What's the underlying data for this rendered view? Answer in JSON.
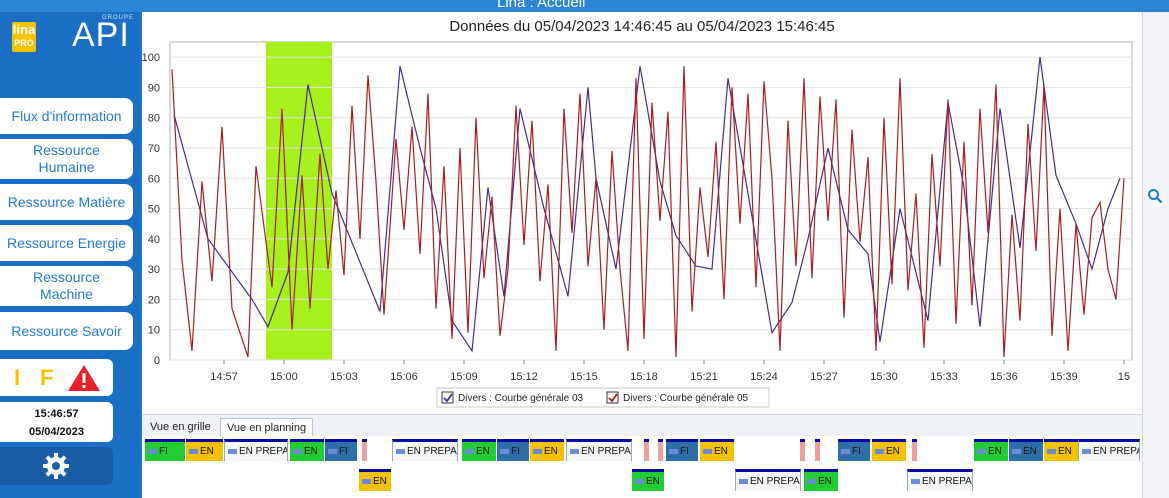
{
  "window": {
    "title": "Lina : Accueil"
  },
  "logo": {
    "lina": "lina",
    "pro": "PRO",
    "api": "API",
    "groupe": "GROUPE"
  },
  "sidebar": {
    "items": [
      {
        "label": "Flux d'information"
      },
      {
        "label": "Ressource Humaine"
      },
      {
        "label": "Ressource Matière"
      },
      {
        "label": "Ressource Energie"
      },
      {
        "label": "Ressource Machine"
      },
      {
        "label": "Ressource Savoir"
      }
    ],
    "alerts": {
      "i": "I",
      "f": "F"
    },
    "clock": {
      "time": "15:46:57",
      "date": "05/04/2023"
    }
  },
  "chart_data": {
    "type": "line",
    "title": "Données du 05/04/2023 14:46:45 au 05/04/2023 15:46:45",
    "ylim": [
      0,
      105
    ],
    "yticks": [
      0,
      10,
      20,
      30,
      40,
      50,
      60,
      70,
      80,
      90,
      100
    ],
    "x_range_min": [
      0,
      60
    ],
    "xticks": [
      {
        "t": 10,
        "label": "14:57"
      },
      {
        "t": 13,
        "label": "15:00"
      },
      {
        "t": 16,
        "label": "15:03"
      },
      {
        "t": 19,
        "label": "15:06"
      },
      {
        "t": 22,
        "label": "15:09"
      },
      {
        "t": 25,
        "label": "15:12"
      },
      {
        "t": 28,
        "label": "15:15"
      },
      {
        "t": 31,
        "label": "15:18"
      },
      {
        "t": 34,
        "label": "15:21"
      },
      {
        "t": 37,
        "label": "15:24"
      },
      {
        "t": 40,
        "label": "15:27"
      },
      {
        "t": 43,
        "label": "15:30"
      },
      {
        "t": 46,
        "label": "15:33"
      },
      {
        "t": 49,
        "label": "15:36"
      },
      {
        "t": 52,
        "label": "15:39"
      },
      {
        "t": 55,
        "label": "15"
      }
    ],
    "highlight": {
      "from": 12.1,
      "to": 15.4,
      "color": "#a6f01e"
    },
    "series": [
      {
        "name": "Divers : Courbe générale 03",
        "color": "#4a2a8a",
        "x": [
          7.5,
          9.2,
          11.4,
          12.2,
          13.2,
          14.2,
          15.4,
          17.8,
          18.8,
          19.8,
          20.6,
          21.4,
          22.4,
          23.2,
          24.0,
          24.8,
          26.0,
          27.2,
          28.2,
          28.6,
          29.6,
          30.8,
          31.8,
          32.6,
          33.6,
          34.4,
          35.2,
          36.2,
          37.4,
          38.4,
          39.2,
          40.2,
          41.2,
          42.2,
          42.8,
          43.8,
          45.2,
          46.2,
          47.0,
          47.8,
          48.8,
          49.8,
          50.8,
          51.6,
          52.6,
          53.4,
          54.2,
          54.8
        ],
        "y": [
          81,
          40,
          20,
          11,
          29,
          91,
          55,
          16,
          97,
          70,
          50,
          13,
          3,
          57,
          21,
          83,
          50,
          21,
          90,
          60,
          30,
          97,
          59,
          41,
          31,
          30,
          93,
          55,
          9,
          19,
          40,
          70,
          43,
          35,
          6,
          50,
          13,
          85,
          57,
          11,
          83,
          37,
          100,
          61,
          45,
          30,
          50,
          60
        ]
      },
      {
        "name": "Divers : Courbe générale 05",
        "color": "#a81e1e",
        "x": [
          7.4,
          7.9,
          8.4,
          8.9,
          9.4,
          9.9,
          10.4,
          11.2,
          11.6,
          12.4,
          12.9,
          13.4,
          13.9,
          14.3,
          14.8,
          15.2,
          15.6,
          16.0,
          16.4,
          16.8,
          17.2,
          17.6,
          18.0,
          18.6,
          19.0,
          19.4,
          19.8,
          20.2,
          20.6,
          21.0,
          21.4,
          21.8,
          22.2,
          22.6,
          23.0,
          23.4,
          23.8,
          24.2,
          24.6,
          25.0,
          25.4,
          25.8,
          26.2,
          26.6,
          27.0,
          27.4,
          27.8,
          28.2,
          28.6,
          29.0,
          29.4,
          29.8,
          30.2,
          30.6,
          31.0,
          31.4,
          31.8,
          32.2,
          32.6,
          33.0,
          33.4,
          33.8,
          34.2,
          34.6,
          35.0,
          35.4,
          35.8,
          36.2,
          36.6,
          37.0,
          37.4,
          37.8,
          38.2,
          38.6,
          39.0,
          39.4,
          39.8,
          40.2,
          40.6,
          41.0,
          41.4,
          41.8,
          42.2,
          42.6,
          43.0,
          43.4,
          43.8,
          44.2,
          44.6,
          45.0,
          45.4,
          45.8,
          46.2,
          46.6,
          47.0,
          47.4,
          47.8,
          48.2,
          48.6,
          49.0,
          49.4,
          49.8,
          50.2,
          50.6,
          51.0,
          51.4,
          51.8,
          52.2,
          52.6,
          53.0,
          53.4,
          53.8,
          54.2,
          54.6,
          55.0
        ],
        "y": [
          96,
          33,
          3,
          59,
          26,
          77,
          17,
          1,
          64,
          24,
          83,
          10,
          61,
          17,
          68,
          30,
          56,
          28,
          84,
          40,
          94,
          59,
          15,
          73,
          43,
          77,
          35,
          88,
          17,
          64,
          7,
          70,
          9,
          80,
          27,
          54,
          8,
          30,
          84,
          38,
          79,
          26,
          58,
          3,
          83,
          42,
          88,
          31,
          60,
          10,
          69,
          30,
          3,
          93,
          7,
          85,
          46,
          82,
          1,
          97,
          16,
          57,
          34,
          72,
          20,
          90,
          45,
          88,
          24,
          92,
          60,
          3,
          79,
          31,
          93,
          27,
          87,
          46,
          86,
          14,
          76,
          39,
          67,
          3,
          80,
          25,
          93,
          23,
          55,
          4,
          68,
          31,
          86,
          12,
          72,
          18,
          83,
          42,
          91,
          1,
          48,
          13,
          78,
          36,
          91,
          8,
          50,
          3,
          45,
          15,
          47,
          52,
          30,
          20,
          60
        ]
      }
    ],
    "legend": [
      "Divers : Courbe générale 03",
      "Divers : Courbe générale 05"
    ]
  },
  "tabs": [
    {
      "label": "Vue en grille",
      "active": false
    },
    {
      "label": "Vue en planning",
      "active": true
    }
  ],
  "planning": {
    "row1": [
      {
        "color": "green",
        "label": "FI"
      },
      {
        "color": "yellow",
        "label": "EN"
      },
      {
        "color": "white",
        "label": "EN PREPA"
      },
      {
        "color": "green",
        "label": "EN"
      },
      {
        "color": "blue",
        "label": "FI"
      },
      {
        "color": "white",
        "label": "EN PREPA"
      },
      {
        "color": "green",
        "label": "EN"
      },
      {
        "color": "blue",
        "label": "FI"
      },
      {
        "color": "yellow",
        "label": "EN"
      },
      {
        "color": "white",
        "label": "EN PREPA"
      },
      {
        "color": "blue",
        "label": "FI"
      },
      {
        "color": "yellow",
        "label": "EN"
      },
      {
        "color": "blue",
        "label": "FI"
      },
      {
        "color": "yellow",
        "label": "EN"
      },
      {
        "color": "green",
        "label": "EN"
      },
      {
        "color": "blue",
        "label": "EN"
      },
      {
        "color": "yellow",
        "label": "EN"
      },
      {
        "color": "white",
        "label": "EN PREPA"
      }
    ],
    "row2": [
      {
        "color": "yellow",
        "label": "EN"
      },
      {
        "color": "green",
        "label": "EN"
      },
      {
        "color": "white",
        "label": "EN PREPA"
      },
      {
        "color": "green",
        "label": "EN"
      },
      {
        "color": "white",
        "label": "EN PREPA"
      }
    ]
  }
}
